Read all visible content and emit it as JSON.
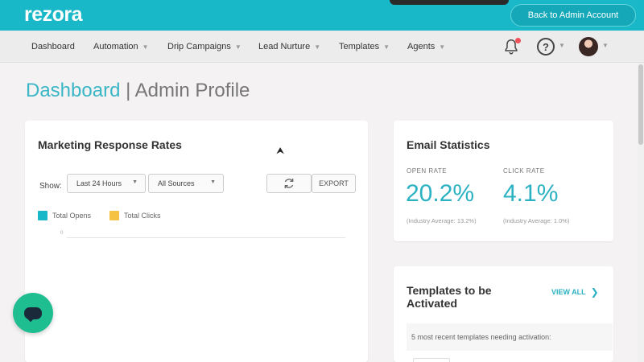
{
  "brand": {
    "logo": "rezora",
    "primary_color": "#18b8c8",
    "accent_color": "#2ab2c3"
  },
  "topbar": {
    "back_button": "Back to Admin Account"
  },
  "nav": {
    "items": [
      {
        "label": "Dashboard"
      },
      {
        "label": "Automation"
      },
      {
        "label": "Drip Campaigns"
      },
      {
        "label": "Lead Nurture"
      },
      {
        "label": "Templates"
      },
      {
        "label": "Agents"
      }
    ],
    "icons": {
      "notifications": "bell-icon",
      "help": "question-circle-icon",
      "profile": "avatar"
    },
    "help_glyph": "?"
  },
  "page": {
    "title_primary": "Dashboard",
    "title_separator": "|",
    "title_secondary": "Admin Profile"
  },
  "marketing": {
    "title": "Marketing Response Rates",
    "show_label": "Show:",
    "period_select": "Last 24 Hours",
    "source_select": "All Sources",
    "export_label": "EXPORT",
    "legend": [
      {
        "name": "Total Opens",
        "color": "#18b8c8"
      },
      {
        "name": "Total Clicks",
        "color": "#f5c242"
      }
    ],
    "axis_zero": "0"
  },
  "email_stats": {
    "title": "Email Statistics",
    "open_rate": {
      "label": "OPEN RATE",
      "value": "20.2%",
      "note": "(Industry Average: 13.2%)"
    },
    "click_rate": {
      "label": "CLICK RATE",
      "value": "4.1%",
      "note": "(Industry Average: 1.0%)"
    }
  },
  "templates": {
    "title": "Templates to be Activated",
    "view_all": "VIEW ALL",
    "note": "5 most recent templates needing activation:"
  }
}
